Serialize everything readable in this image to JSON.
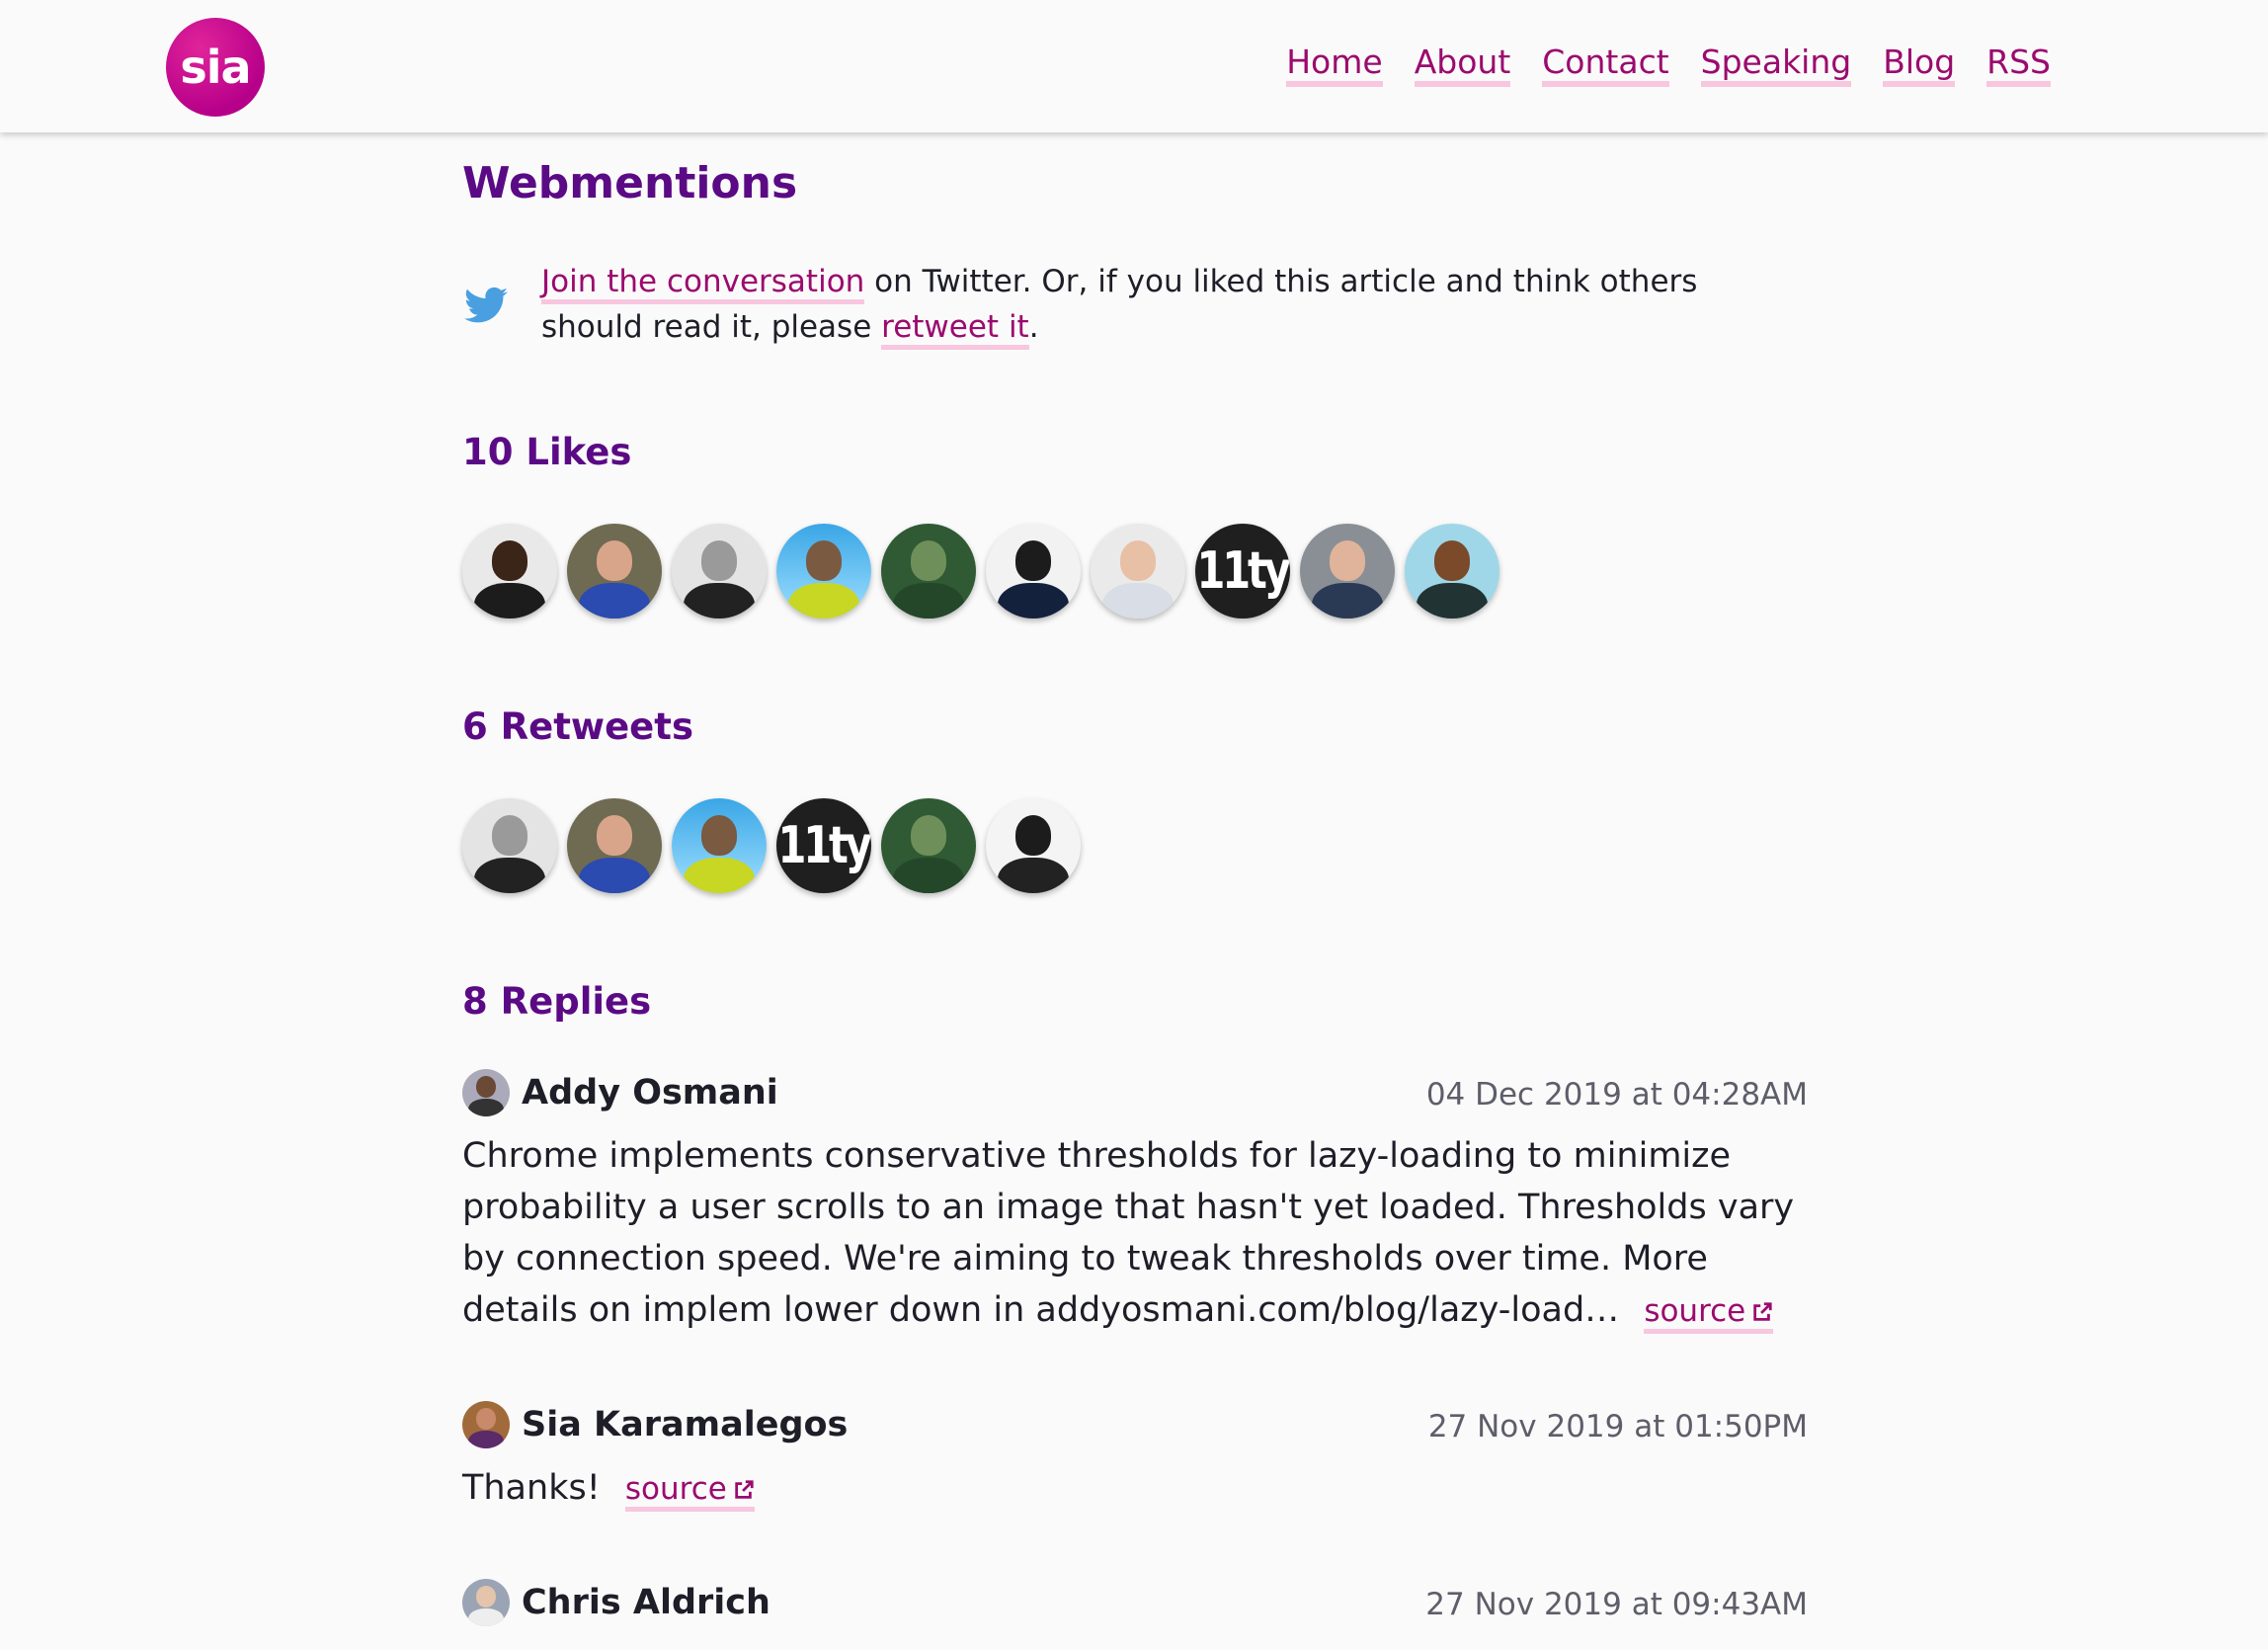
{
  "header": {
    "logo_text": "sia",
    "nav": [
      "Home",
      "About",
      "Contact",
      "Speaking",
      "Blog",
      "RSS"
    ]
  },
  "main": {
    "title": "Webmentions",
    "intro": {
      "link1": "Join the conversation",
      "text1": " on Twitter. Or, if you liked this article and think others should read it, please ",
      "link2": "retweet it",
      "text2": "."
    },
    "likes_title": "10 Likes",
    "retweets_title": "6 Retweets",
    "replies_title": "8 Replies",
    "replies": [
      {
        "author": "Addy Osmani",
        "date": "04 Dec 2019 at 04:28AM",
        "text": "Chrome implements conservative thresholds for lazy-loading to minimize probability a user scrolls to an image that hasn't yet loaded. Thresholds vary by connection speed. We're aiming to tweak thresholds over time. More details on implem lower down in addyosmani.com/blog/lazy-load…",
        "source_label": "source"
      },
      {
        "author": "Sia Karamalegos",
        "date": "27 Nov 2019 at 01:50PM",
        "text": "Thanks!",
        "source_label": "source"
      },
      {
        "author": "Chris Aldrich",
        "date": "27 Nov 2019 at 09:43AM"
      }
    ]
  },
  "colors": {
    "brand": "#b7008a",
    "link": "#9b0a6e",
    "link_underline": "#f8c6de",
    "heading": "#5b0a85",
    "twitter": "#4a9fe0"
  },
  "avatar_labels": {
    "eleventy": "11ty"
  }
}
